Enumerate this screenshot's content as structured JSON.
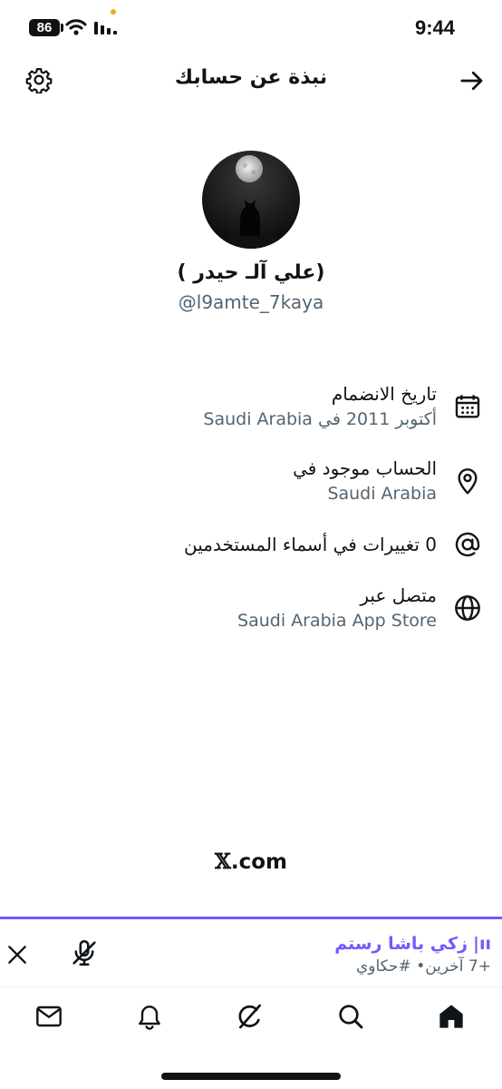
{
  "status_bar": {
    "battery": "86",
    "time": "9:44"
  },
  "header": {
    "title": "نبذة عن حسابك",
    "settings_icon": "gear-icon",
    "back_icon": "arrow-right-icon"
  },
  "profile": {
    "display_name": "(علي آلـ حيدر )",
    "handle": "@l9amte_7kaya"
  },
  "info": [
    {
      "icon": "calendar-icon",
      "label": "تاريخ الانضمام",
      "value": "أكتوبر 2011 في Saudi Arabia"
    },
    {
      "icon": "location-pin-icon",
      "label": "الحساب موجود في",
      "value": "Saudi Arabia"
    },
    {
      "icon": "at-sign-icon",
      "label": "0 تغييرات في أسماء المستخدمين",
      "value": ""
    },
    {
      "icon": "globe-icon",
      "label": "متصل عبر",
      "value": "Saudi Arabia App Store"
    }
  ],
  "brand": {
    "x": "𝕏",
    "domain": ".com"
  },
  "spaces": {
    "host": "زكي باشا رستم",
    "subtitle": "+7 آخرين• #حكاوي",
    "accent": "#7856ff"
  },
  "bottom_nav": [
    {
      "name": "messages",
      "icon": "mail-icon"
    },
    {
      "name": "notifications",
      "icon": "bell-icon"
    },
    {
      "name": "grok",
      "icon": "grok-icon"
    },
    {
      "name": "search",
      "icon": "search-icon"
    },
    {
      "name": "home",
      "icon": "home-icon"
    }
  ]
}
